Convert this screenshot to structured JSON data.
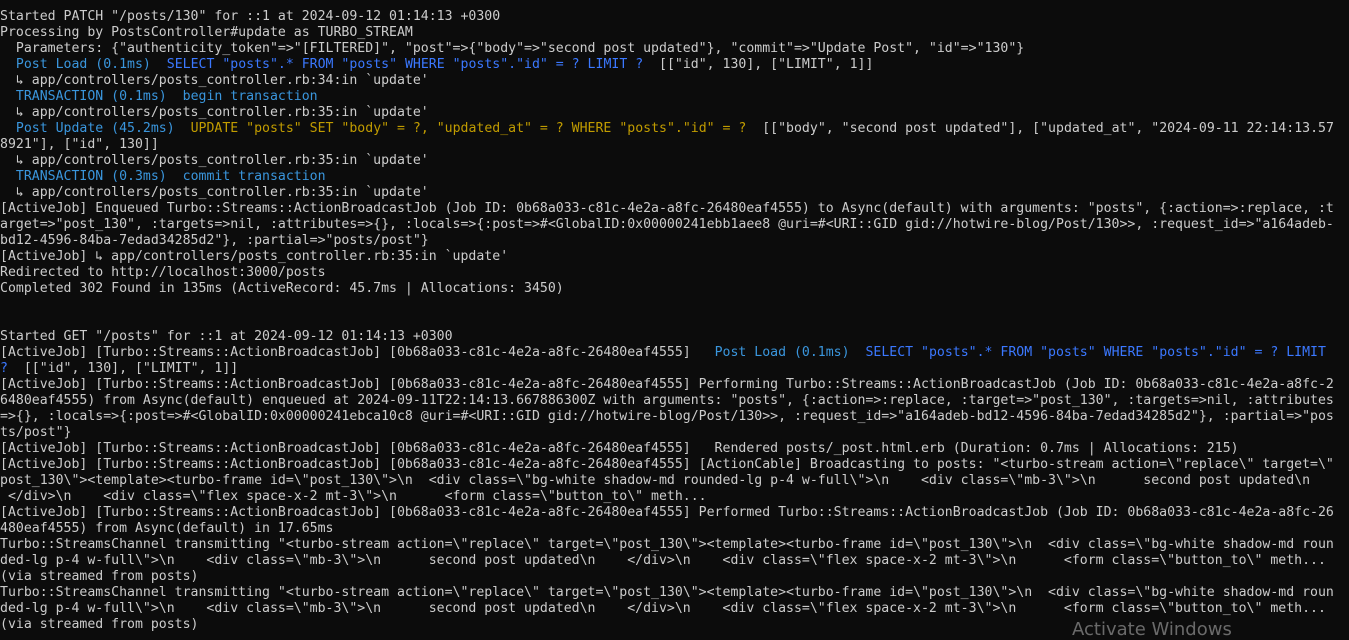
{
  "colors": {
    "background": "#0c0c0c",
    "default_text": "#cccccc",
    "sql_label_cyan": "#3a96dd",
    "sql_select_blue": "#3b78ff",
    "sql_update_yellow": "#c19c00",
    "bright_white": "#f2f2f2"
  },
  "watermark": "Activate Windows",
  "log_lines": [
    [
      {
        "text": "Started PATCH \"/posts/130\" for ::1 at 2024-09-12 01:14:13 +0300"
      }
    ],
    [
      {
        "text": "Processing by PostsController#update as TURBO_STREAM"
      }
    ],
    [
      {
        "text": "  Parameters: {\"authenticity_token\"=>\"[FILTERED]\", \"post\"=>{\"body\"=>\"second post updated\"}, \"commit\"=>\"Update Post\", \"id\"=>\"130\"}"
      }
    ],
    [
      {
        "text": "  "
      },
      {
        "text": "Post Load (0.1ms)",
        "style": "cyan"
      },
      {
        "text": "  "
      },
      {
        "text": "SELECT \"posts\".* FROM \"posts\" WHERE \"posts\".\"id\" = ? LIMIT ?",
        "style": "blue"
      },
      {
        "text": "  [[\"id\", 130], [\"LIMIT\", 1]]"
      }
    ],
    [
      {
        "text": "  ↳ app/controllers/posts_controller.rb:34:in `update'"
      }
    ],
    [
      {
        "text": "  "
      },
      {
        "text": "TRANSACTION (0.1ms)",
        "style": "cyan"
      },
      {
        "text": "  "
      },
      {
        "text": "begin transaction",
        "style": "cyan"
      }
    ],
    [
      {
        "text": "  ↳ app/controllers/posts_controller.rb:35:in `update'"
      }
    ],
    [
      {
        "text": "  "
      },
      {
        "text": "Post Update (45.2ms)",
        "style": "cyan"
      },
      {
        "text": "  "
      },
      {
        "text": "UPDATE \"posts\" SET \"body\" = ?, \"updated_at\" = ? WHERE \"posts\".\"id\" = ?",
        "style": "yellow"
      },
      {
        "text": "  [[\"body\", \"second post updated\"], [\"updated_at\", \"2024-09-11 22:14:13.57"
      }
    ],
    [
      {
        "text": "8921\"], [\"id\", 130]]"
      }
    ],
    [
      {
        "text": "  ↳ app/controllers/posts_controller.rb:35:in `update'"
      }
    ],
    [
      {
        "text": "  "
      },
      {
        "text": "TRANSACTION (0.3ms)",
        "style": "cyan"
      },
      {
        "text": "  "
      },
      {
        "text": "commit transaction",
        "style": "cyan"
      }
    ],
    [
      {
        "text": "  ↳ app/controllers/posts_controller.rb:35:in `update'"
      }
    ],
    [
      {
        "text": "[ActiveJob] Enqueued Turbo::Streams::ActionBroadcastJob (Job ID: 0b68a033-c81c-4e2a-a8fc-26480eaf4555) to Async(default) with arguments: \"posts\", {:action=>:replace, :t"
      }
    ],
    [
      {
        "text": "arget=>\"post_130\", :targets=>nil, :attributes=>{}, :locals=>{:post=>#<GlobalID:0x00000241ebb1aee8 @uri=#<URI::GID gid://hotwire-blog/Post/130>>, :request_id=>\"a164adeb-"
      }
    ],
    [
      {
        "text": "bd12-4596-84ba-7edad34285d2\"}, :partial=>\"posts/post\"}"
      }
    ],
    [
      {
        "text": "[ActiveJob] ↳ app/controllers/posts_controller.rb:35:in `update'"
      }
    ],
    [
      {
        "text": "Redirected to http://localhost:3000/posts"
      }
    ],
    [
      {
        "text": "Completed 302 Found in 135ms (ActiveRecord: 45.7ms | Allocations: 3450)"
      }
    ],
    [
      {
        "text": ""
      }
    ],
    [
      {
        "text": ""
      }
    ],
    [
      {
        "text": "Started GET \"/posts\" for ::1 at 2024-09-12 01:14:13 +0300"
      }
    ],
    [
      {
        "text": "[ActiveJob] [Turbo::Streams::ActionBroadcastJob] [0b68a033-c81c-4e2a-a8fc-26480eaf4555]   "
      },
      {
        "text": "Post Load (0.1ms)",
        "style": "cyan"
      },
      {
        "text": "  "
      },
      {
        "text": "SELECT \"posts\".* FROM \"posts\" WHERE \"posts\".\"id\" = ? LIMIT",
        "style": "blue"
      }
    ],
    [
      {
        "text": "?",
        "style": "blue"
      },
      {
        "text": "  [[\"id\", 130], [\"LIMIT\", 1]]"
      }
    ],
    [
      {
        "text": "[ActiveJob] [Turbo::Streams::ActionBroadcastJob] [0b68a033-c81c-4e2a-a8fc-26480eaf4555] Performing Turbo::Streams::ActionBroadcastJob (Job ID: 0b68a033-c81c-4e2a-a8fc-2"
      }
    ],
    [
      {
        "text": "6480eaf4555) from Async(default) enqueued at 2024-09-11T22:14:13.667886300Z with arguments: \"posts\", {:action=>:replace, :target=>\"post_130\", :targets=>nil, :attributes"
      }
    ],
    [
      {
        "text": "=>{}, :locals=>{:post=>#<GlobalID:0x00000241ebca10c8 @uri=#<URI::GID gid://hotwire-blog/Post/130>>, :request_id=>\"a164adeb-bd12-4596-84ba-7edad34285d2\"}, :partial=>\"pos"
      }
    ],
    [
      {
        "text": "ts/post\"}"
      }
    ],
    [
      {
        "text": "[ActiveJob] [Turbo::Streams::ActionBroadcastJob] [0b68a033-c81c-4e2a-a8fc-26480eaf4555]   Rendered posts/_post.html.erb (Duration: 0.7ms | Allocations: 215)"
      }
    ],
    [
      {
        "text": "[ActiveJob] [Turbo::Streams::ActionBroadcastJob] [0b68a033-c81c-4e2a-a8fc-26480eaf4555] [ActionCable] Broadcasting to posts: \"<turbo-stream action=\\\"replace\\\" target=\\\""
      }
    ],
    [
      {
        "text": "post_130\\\"><template><turbo-frame id=\\\"post_130\\\">\\n  <div class=\\\"bg-white shadow-md rounded-lg p-4 w-full\\\">\\n    <div class=\\\"mb-3\\\">\\n      second post updated\\n"
      }
    ],
    [
      {
        "text": " </div>\\n    <div class=\\\"flex space-x-2 mt-3\\\">\\n      <form class=\\\"button_to\\\" meth..."
      }
    ],
    [
      {
        "text": "[ActiveJob] [Turbo::Streams::ActionBroadcastJob] [0b68a033-c81c-4e2a-a8fc-26480eaf4555] Performed Turbo::Streams::ActionBroadcastJob (Job ID: 0b68a033-c81c-4e2a-a8fc-26"
      }
    ],
    [
      {
        "text": "480eaf4555) from Async(default) in 17.65ms"
      }
    ],
    [
      {
        "text": "Turbo::StreamsChannel transmitting \"<turbo-stream action=\\\"replace\\\" target=\\\"post_130\\\"><template><turbo-frame id=\\\"post_130\\\">\\n  <div class=\\\"bg-white shadow-md roun"
      }
    ],
    [
      {
        "text": "ded-lg p-4 w-full\\\">\\n    <div class=\\\"mb-3\\\">\\n      second post updated\\n    </div>\\n    <div class=\\\"flex space-x-2 mt-3\\\">\\n      <form class=\\\"button_to\\\" meth..."
      }
    ],
    [
      {
        "text": "(via streamed from posts)"
      }
    ],
    [
      {
        "text": "Turbo::StreamsChannel transmitting \"<turbo-stream action=\\\"replace\\\" target=\\\"post_130\\\"><template><turbo-frame id=\\\"post_130\\\">\\n  <div class=\\\"bg-white shadow-md roun"
      }
    ],
    [
      {
        "text": "ded-lg p-4 w-full\\\">\\n    <div class=\\\"mb-3\\\">\\n      second post updated\\n    </div>\\n    <div class=\\\"flex space-x-2 mt-3\\\">\\n      <form class=\\\"button_to\\\" meth..."
      }
    ],
    [
      {
        "text": "(via streamed from posts)"
      }
    ]
  ]
}
